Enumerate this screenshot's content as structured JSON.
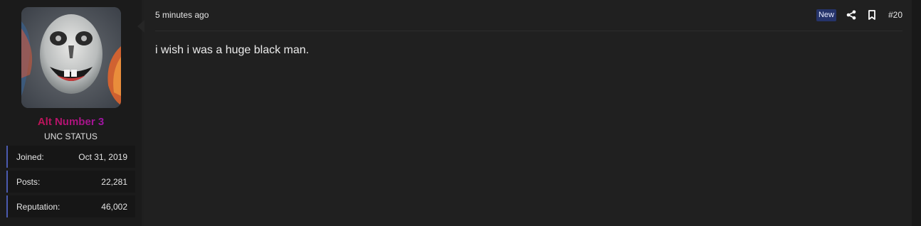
{
  "user": {
    "name": "Alt Number 3",
    "title": "UNC STATUS",
    "name_gradient": [
      "#d0162a",
      "#8a18d4"
    ],
    "stats": [
      {
        "label": "Joined:",
        "value": "Oct 31, 2019"
      },
      {
        "label": "Posts:",
        "value": "22,281"
      },
      {
        "label": "Reputation:",
        "value": "46,002"
      }
    ],
    "avatar_icon": "clown-face-avatar"
  },
  "post": {
    "timestamp": "5 minutes ago",
    "badge": "New",
    "share_icon": "share-icon",
    "bookmark_icon": "bookmark-icon",
    "number": "#20",
    "body": "i wish i was a huge black man."
  },
  "colors": {
    "background": "#1f1f1f",
    "user_cell": "#1b1b1b",
    "badge_bg": "#25336a",
    "stat_accent": "#4b5bb0"
  }
}
